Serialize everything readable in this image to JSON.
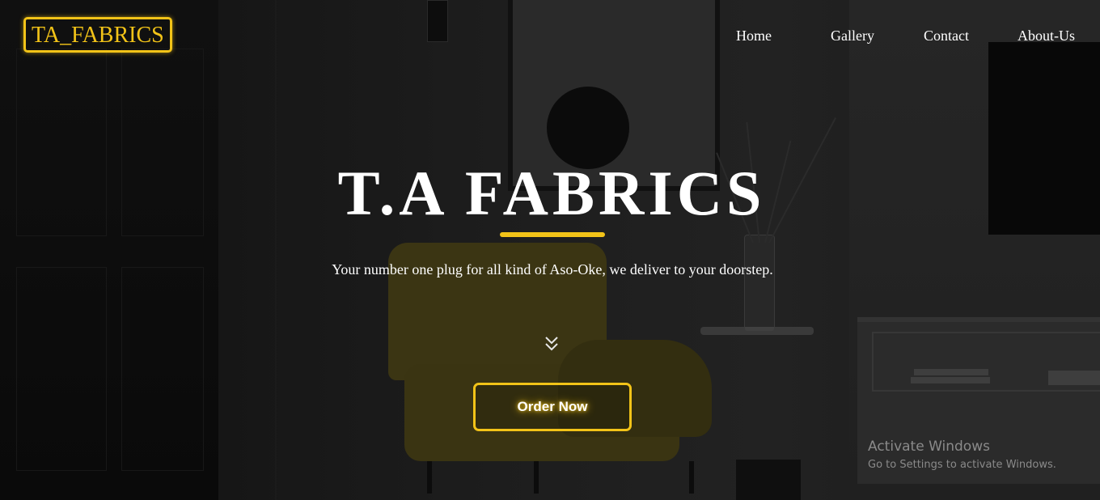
{
  "header": {
    "logo_text": "TA_FABRICS",
    "nav": [
      {
        "label": "Home"
      },
      {
        "label": "Gallery"
      },
      {
        "label": "Contact"
      },
      {
        "label": "About-Us"
      }
    ]
  },
  "hero": {
    "title": "T.A FABRICS",
    "tagline": "Your number one plug for all kind of Aso-Oke, we deliver to your doorstep.",
    "scroll_icon": "double-chevron-down-icon",
    "cta_label": "Order Now"
  },
  "watermark": {
    "title": "Activate Windows",
    "subtitle": "Go to Settings to activate Windows."
  },
  "colors": {
    "accent": "#f2c318",
    "text": "#ffffff",
    "background": "#1a1a1a"
  }
}
